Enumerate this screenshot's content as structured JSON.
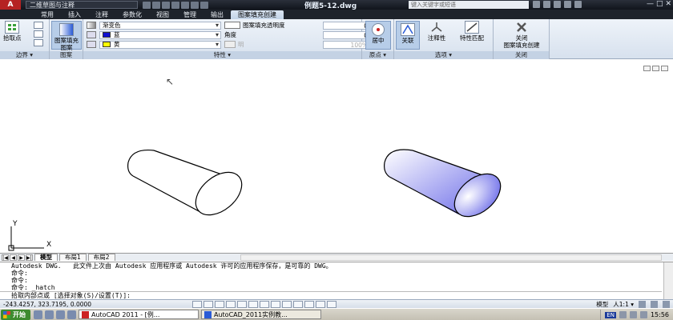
{
  "titlebar": {
    "app_logo": "A",
    "workspace": "二维草图与注释",
    "document_title": "例题5-12.dwg",
    "search_placeholder": "键入关键字或短语",
    "window_buttons": [
      "—",
      "□",
      "✕"
    ]
  },
  "tabs": [
    "常用",
    "插入",
    "注释",
    "参数化",
    "视图",
    "管理",
    "输出",
    "图案填充创建"
  ],
  "active_tab": "图案填充创建",
  "ribbon": {
    "boundary": {
      "button": "拾取点",
      "label": "边界 ▾"
    },
    "pattern": {
      "button": "图案填充图案",
      "label": "图案"
    },
    "properties": {
      "label": "特性 ▾",
      "type_value": "渐变色",
      "color1_value": "蓝",
      "color1_swatch": "#1010d0",
      "color2_value": "黄",
      "color2_swatch": "#ffff00",
      "transparency_label": "图案填充透明度",
      "transparency_value": "0",
      "angle_label": "角度",
      "angle_value": "0",
      "tint_label": "明",
      "tint_value": "100%"
    },
    "origin": {
      "button": "居中",
      "label": "原点 ▾"
    },
    "options": {
      "label": "选项 ▾",
      "associative": "关联",
      "annotative": "注释性",
      "match_properties": "特性匹配"
    },
    "close": {
      "button": "关闭\n图案填充创建",
      "label": "关闭"
    }
  },
  "drawing": {
    "ucs_x": "X",
    "ucs_y": "Y",
    "gradient_color_a": "#ffffff",
    "gradient_color_b": "#6a6ae8"
  },
  "layout_tabs": [
    "模型",
    "布局1",
    "布局2"
  ],
  "active_layout_tab": "模型",
  "command": {
    "history": [
      "Autodesk DWG.   此文件上次由 Autodesk 应用程序或 Autodesk 许可的应用程序保存，是可靠的 DWG。",
      "命令:",
      "命令:",
      "命令: _hatch"
    ],
    "prompt": "拾取内部点或 [选择对象(S)/设置(T)]:"
  },
  "statusbar": {
    "coords": "-243.4257, 323.7195, 0.0000",
    "model": "模型",
    "scale": "人1:1 ▾"
  },
  "taskbar": {
    "start": "开始",
    "tasks": [
      "AutoCAD 2011 - [例...",
      "AutoCAD_2011实例教..."
    ],
    "lang": "EN",
    "time": "15:56"
  }
}
